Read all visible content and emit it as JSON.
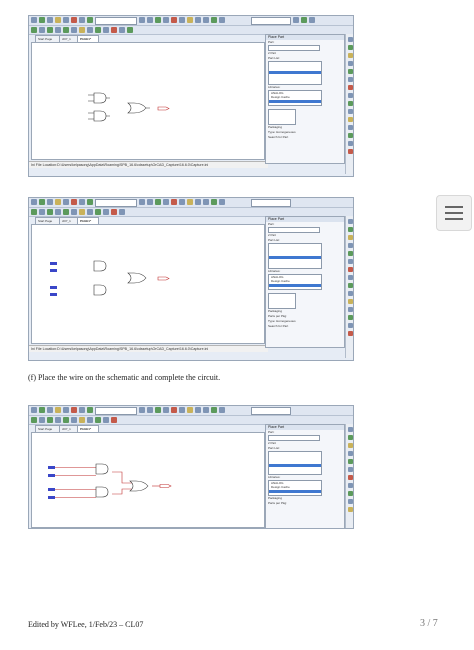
{
  "page": {
    "caption_f": "(f) Place the wire on the schematic and complete the circuit.",
    "footer": "Edited by WFLee, 1/Feb/23 – CL07",
    "pager": "3 / 7"
  },
  "screens": [
    {
      "tabs": [
        "Start Page",
        "cl07_1",
        "PAGE1*"
      ],
      "status": "Ini File Location:D:\\Users\\kelpasong\\AppData\\Roaming\\SPB_16.6\\cdssetup\\OrCAD_Capture\\16.6.0\\Capture.ini",
      "place_part": {
        "title": "Place Part",
        "part_label": "Part:",
        "part_value": "2 Part",
        "part_list_label": "Part List:",
        "libraries_label": "Libraries:",
        "lib_items": [
          "ANALOG",
          "Design Cache"
        ],
        "packaging_label": "Packaging",
        "type_label": "Type: Homogeneous",
        "search_label": "Search for Part"
      }
    },
    {
      "tabs": [
        "Start Page",
        "cl07_1",
        "PAGE1*"
      ],
      "status": "Ini File Location:D:\\Users\\kelpasong\\AppData\\Roaming\\SPB_16.6\\cdssetup\\OrCAD_Capture\\16.6.0\\Capture.ini",
      "place_part": {
        "title": "Place Part",
        "part_label": "Part:",
        "part_value": "2 Part",
        "part_list_label": "Part List:",
        "libraries_label": "Libraries:",
        "lib_items": [
          "ANALOG",
          "Design Cache"
        ],
        "packaging_label": "Packaging",
        "parts_label": "Parts per Pkg:",
        "type_label": "Type: Homogeneous",
        "search_label": "Search for Part"
      }
    },
    {
      "tabs": [
        "Start Page",
        "cl07_1",
        "PAGE1*"
      ],
      "place_part": {
        "title": "Place Part",
        "part_label": "Part:",
        "part_value": "2 Part",
        "part_list_label": "Part List:",
        "libraries_label": "Libraries:",
        "lib_items": [
          "ANALOG",
          "Design Cache"
        ],
        "packaging_label": "Packaging",
        "parts_label": "Parts per Pkg:"
      }
    }
  ]
}
